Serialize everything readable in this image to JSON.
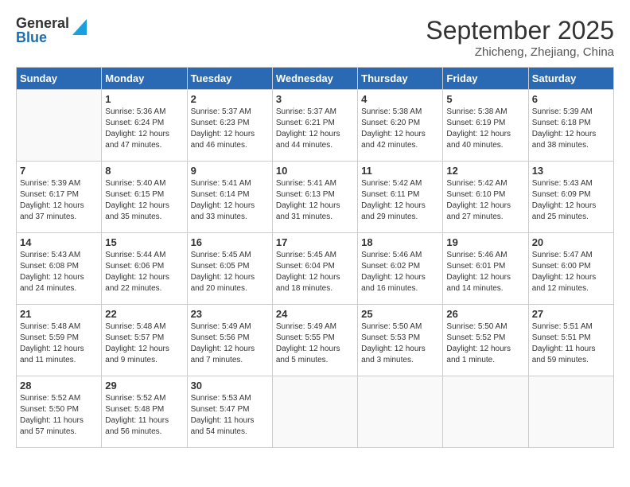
{
  "header": {
    "logo_general": "General",
    "logo_blue": "Blue",
    "month_title": "September 2025",
    "location": "Zhicheng, Zhejiang, China"
  },
  "days_of_week": [
    "Sunday",
    "Monday",
    "Tuesday",
    "Wednesday",
    "Thursday",
    "Friday",
    "Saturday"
  ],
  "weeks": [
    [
      {
        "day": "",
        "info": ""
      },
      {
        "day": "1",
        "info": "Sunrise: 5:36 AM\nSunset: 6:24 PM\nDaylight: 12 hours\nand 47 minutes."
      },
      {
        "day": "2",
        "info": "Sunrise: 5:37 AM\nSunset: 6:23 PM\nDaylight: 12 hours\nand 46 minutes."
      },
      {
        "day": "3",
        "info": "Sunrise: 5:37 AM\nSunset: 6:21 PM\nDaylight: 12 hours\nand 44 minutes."
      },
      {
        "day": "4",
        "info": "Sunrise: 5:38 AM\nSunset: 6:20 PM\nDaylight: 12 hours\nand 42 minutes."
      },
      {
        "day": "5",
        "info": "Sunrise: 5:38 AM\nSunset: 6:19 PM\nDaylight: 12 hours\nand 40 minutes."
      },
      {
        "day": "6",
        "info": "Sunrise: 5:39 AM\nSunset: 6:18 PM\nDaylight: 12 hours\nand 38 minutes."
      }
    ],
    [
      {
        "day": "7",
        "info": "Sunrise: 5:39 AM\nSunset: 6:17 PM\nDaylight: 12 hours\nand 37 minutes."
      },
      {
        "day": "8",
        "info": "Sunrise: 5:40 AM\nSunset: 6:15 PM\nDaylight: 12 hours\nand 35 minutes."
      },
      {
        "day": "9",
        "info": "Sunrise: 5:41 AM\nSunset: 6:14 PM\nDaylight: 12 hours\nand 33 minutes."
      },
      {
        "day": "10",
        "info": "Sunrise: 5:41 AM\nSunset: 6:13 PM\nDaylight: 12 hours\nand 31 minutes."
      },
      {
        "day": "11",
        "info": "Sunrise: 5:42 AM\nSunset: 6:11 PM\nDaylight: 12 hours\nand 29 minutes."
      },
      {
        "day": "12",
        "info": "Sunrise: 5:42 AM\nSunset: 6:10 PM\nDaylight: 12 hours\nand 27 minutes."
      },
      {
        "day": "13",
        "info": "Sunrise: 5:43 AM\nSunset: 6:09 PM\nDaylight: 12 hours\nand 25 minutes."
      }
    ],
    [
      {
        "day": "14",
        "info": "Sunrise: 5:43 AM\nSunset: 6:08 PM\nDaylight: 12 hours\nand 24 minutes."
      },
      {
        "day": "15",
        "info": "Sunrise: 5:44 AM\nSunset: 6:06 PM\nDaylight: 12 hours\nand 22 minutes."
      },
      {
        "day": "16",
        "info": "Sunrise: 5:45 AM\nSunset: 6:05 PM\nDaylight: 12 hours\nand 20 minutes."
      },
      {
        "day": "17",
        "info": "Sunrise: 5:45 AM\nSunset: 6:04 PM\nDaylight: 12 hours\nand 18 minutes."
      },
      {
        "day": "18",
        "info": "Sunrise: 5:46 AM\nSunset: 6:02 PM\nDaylight: 12 hours\nand 16 minutes."
      },
      {
        "day": "19",
        "info": "Sunrise: 5:46 AM\nSunset: 6:01 PM\nDaylight: 12 hours\nand 14 minutes."
      },
      {
        "day": "20",
        "info": "Sunrise: 5:47 AM\nSunset: 6:00 PM\nDaylight: 12 hours\nand 12 minutes."
      }
    ],
    [
      {
        "day": "21",
        "info": "Sunrise: 5:48 AM\nSunset: 5:59 PM\nDaylight: 12 hours\nand 11 minutes."
      },
      {
        "day": "22",
        "info": "Sunrise: 5:48 AM\nSunset: 5:57 PM\nDaylight: 12 hours\nand 9 minutes."
      },
      {
        "day": "23",
        "info": "Sunrise: 5:49 AM\nSunset: 5:56 PM\nDaylight: 12 hours\nand 7 minutes."
      },
      {
        "day": "24",
        "info": "Sunrise: 5:49 AM\nSunset: 5:55 PM\nDaylight: 12 hours\nand 5 minutes."
      },
      {
        "day": "25",
        "info": "Sunrise: 5:50 AM\nSunset: 5:53 PM\nDaylight: 12 hours\nand 3 minutes."
      },
      {
        "day": "26",
        "info": "Sunrise: 5:50 AM\nSunset: 5:52 PM\nDaylight: 12 hours\nand 1 minute."
      },
      {
        "day": "27",
        "info": "Sunrise: 5:51 AM\nSunset: 5:51 PM\nDaylight: 11 hours\nand 59 minutes."
      }
    ],
    [
      {
        "day": "28",
        "info": "Sunrise: 5:52 AM\nSunset: 5:50 PM\nDaylight: 11 hours\nand 57 minutes."
      },
      {
        "day": "29",
        "info": "Sunrise: 5:52 AM\nSunset: 5:48 PM\nDaylight: 11 hours\nand 56 minutes."
      },
      {
        "day": "30",
        "info": "Sunrise: 5:53 AM\nSunset: 5:47 PM\nDaylight: 11 hours\nand 54 minutes."
      },
      {
        "day": "",
        "info": ""
      },
      {
        "day": "",
        "info": ""
      },
      {
        "day": "",
        "info": ""
      },
      {
        "day": "",
        "info": ""
      }
    ]
  ]
}
